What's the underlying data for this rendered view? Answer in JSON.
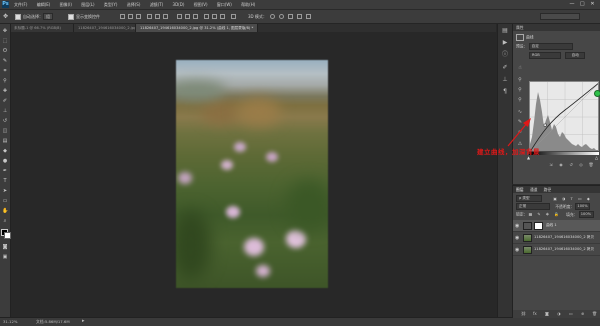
{
  "app": {
    "logo": "Ps",
    "menu": [
      "文件(F)",
      "编辑(E)",
      "图像(I)",
      "图层(L)",
      "类型(Y)",
      "选择(S)",
      "滤镜(T)",
      "3D(D)",
      "视图(V)",
      "窗口(W)",
      "帮助(H)"
    ],
    "window_controls": [
      "—",
      "□",
      "✕"
    ]
  },
  "options": {
    "auto_select_label": "自动选择：",
    "auto_select_target": "组",
    "show_transform_label": "显示变换控件",
    "mode_3d_label": "3D 模式："
  },
  "tabs": [
    {
      "label": "未标题-1 @ 66.7% (RGB/8)",
      "active": false
    },
    {
      "label": "11826407_194616034000_2.jpg @ 36.1%(图层 1, RGB/8)",
      "active": false
    },
    {
      "label": "11826407_194616034000_2.jpg @ 31.2% (曲线 1, 图层蒙版/8) *",
      "active": true
    }
  ],
  "properties": {
    "header": "属性",
    "panel_title": "曲线",
    "preset_label": "预设：",
    "preset_value": "自定",
    "channel_value": "RGB",
    "auto_label": "自动"
  },
  "layers": {
    "tabs": [
      "图层",
      "通道",
      "路径"
    ],
    "kind_label": "ρ 类型",
    "blend_mode": "正常",
    "opacity_label": "不透明度：",
    "opacity_value": "100%",
    "lock_label": "锁定：",
    "fill_label": "填充：",
    "fill_value": "100%",
    "items": [
      {
        "name": "曲线 1",
        "type": "adjustment",
        "selected": true
      },
      {
        "name": "11826407_194616034000_2 拷贝",
        "type": "image",
        "selected": false
      },
      {
        "name": "11826407_194616034000_2 拷贝",
        "type": "image",
        "selected": false
      }
    ]
  },
  "status": {
    "zoom": "31.12%",
    "doc_size": "文档:5.86M/17.6M"
  },
  "annotation": {
    "text": "建立曲线，加深背景",
    "color": "#e01818"
  }
}
